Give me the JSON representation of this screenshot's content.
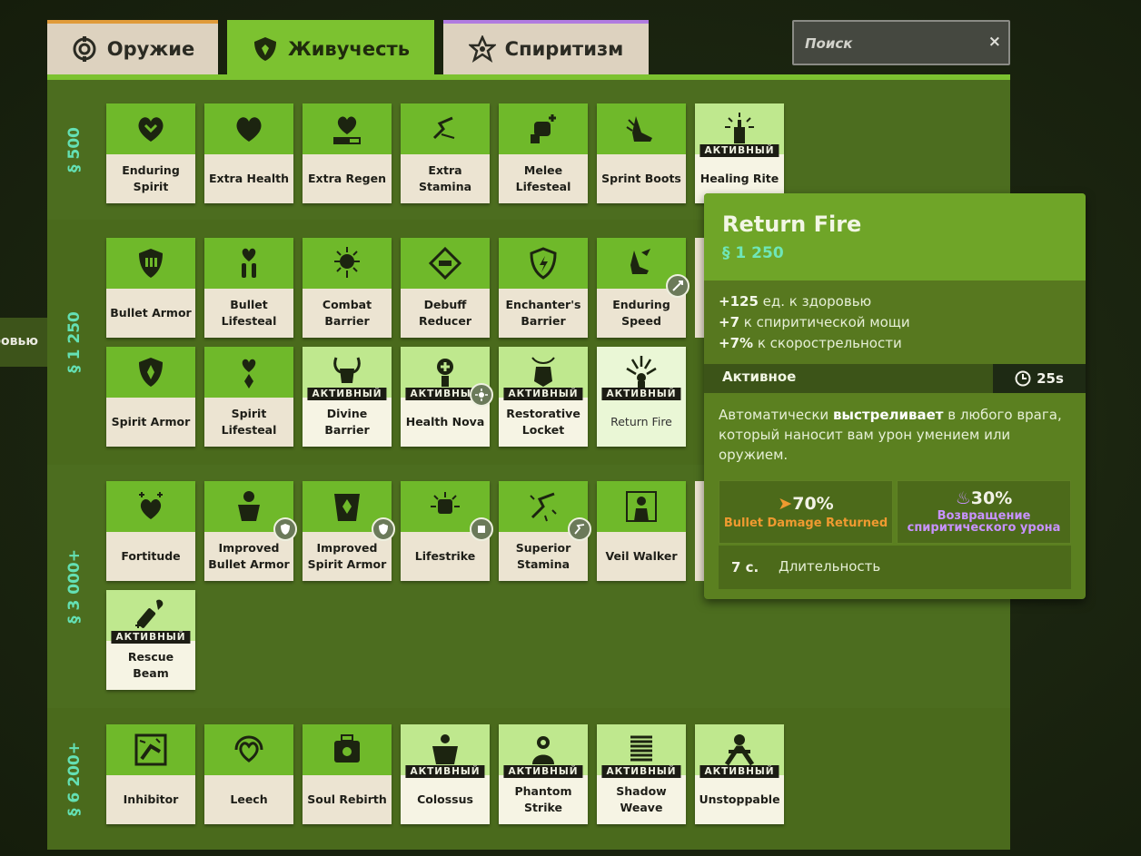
{
  "tabs": [
    {
      "label": "Оружие",
      "icon": "weapon-icon"
    },
    {
      "label": "Живучесть",
      "icon": "vitality-shield-icon"
    },
    {
      "label": "Спиритизм",
      "icon": "spirit-star-icon"
    }
  ],
  "search": {
    "placeholder": "Поиск",
    "clear": "×"
  },
  "side_label": "ровью",
  "badge_text": "АКТИВНЫЙ",
  "tiers": [
    {
      "price": "500",
      "items": [
        "Enduring Spirit",
        "Extra Health",
        "Extra Regen",
        "Extra Stamina",
        "Melee Lifesteal",
        "Sprint Boots",
        "Healing Rite"
      ]
    },
    {
      "price": "1 250",
      "items": [
        "Bullet Armor",
        "Bullet Lifesteal",
        "Combat Barrier",
        "Debuff Reducer",
        "Enchanter's Barrier",
        "Enduring Speed",
        "Spirit Armor",
        "Spirit Lifesteal",
        "Divine Barrier",
        "Health Nova",
        "Restorative Locket",
        "Return Fire"
      ]
    },
    {
      "price": "3 000+",
      "items": [
        "Fortitude",
        "Improved Bullet Armor",
        "Improved Spirit Armor",
        "Lifestrike",
        "Superior Stamina",
        "Veil Walker",
        "Rescue Beam"
      ]
    },
    {
      "price": "6 200+",
      "items": [
        "Inhibitor",
        "Leech",
        "Soul Rebirth",
        "Colossus",
        "Phantom Strike",
        "Shadow Weave",
        "Unstoppable"
      ]
    }
  ],
  "tooltip": {
    "title": "Return Fire",
    "price": "1 250",
    "stats": [
      {
        "value": "+125",
        "label": "ед. к здоровью"
      },
      {
        "value": "+7",
        "label": "к спиритической мощи"
      },
      {
        "value": "+7%",
        "label": "к скорострельности"
      }
    ],
    "active_label": "Активное",
    "cooldown": "25s",
    "description_pre": "Автоматически ",
    "description_bold": "выстреливает",
    "description_post": " в любого врага, который наносит вам урон умением или оружием.",
    "box1": {
      "value": "70%",
      "caption": "Bullet Damage Returned"
    },
    "box2": {
      "value": "30%",
      "caption_line1": "Возвращение",
      "caption_line2": "спиритического урона"
    },
    "duration_value": "7 с.",
    "duration_label": "Длительность"
  },
  "colors": {
    "accent": "#7cc230",
    "panel": "#4c6d1f",
    "card_header": "#6fb92a",
    "price": "#64e0b4",
    "weapon_tab": "#e09b3a",
    "spirit_tab": "#b07be0",
    "spirit_caption": "#c892ff",
    "weapon_caption": "#ef9a30"
  }
}
